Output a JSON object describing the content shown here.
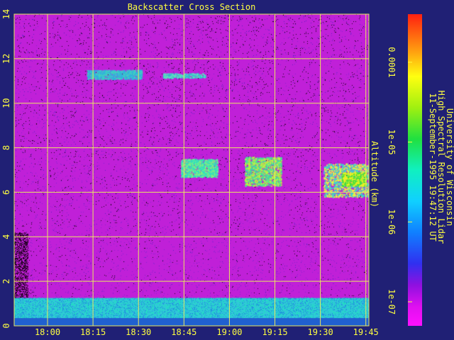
{
  "colors": {
    "background": "#202075",
    "axis_text": "#ffff40",
    "grid": "#e8e860",
    "plot_base": "#c020d8"
  },
  "chart_data": {
    "type": "heatmap",
    "title": "Backscatter Cross Section",
    "xlabel": "",
    "ylabel": "Altitude (km)",
    "x_ticks": [
      "18:00",
      "18:15",
      "18:30",
      "18:45",
      "19:00",
      "19:15",
      "19:30",
      "19:45"
    ],
    "x_range": [
      "17:49",
      "19:46"
    ],
    "y_ticks": [
      0,
      2,
      4,
      6,
      8,
      10,
      12,
      14
    ],
    "ylim": [
      0,
      14
    ],
    "grid": true,
    "colorbar": {
      "scale": "log",
      "range": [
        5e-08,
        0.0004
      ],
      "tick_labels": [
        "1e-07",
        "1e-06",
        "1e-05",
        "0.0001"
      ]
    },
    "annotation": {
      "institution": "University of Wisconsin",
      "instrument": "High Spectral Resolution Lidar",
      "timestamp": "11-September-1995 19:47:12 UT"
    }
  }
}
